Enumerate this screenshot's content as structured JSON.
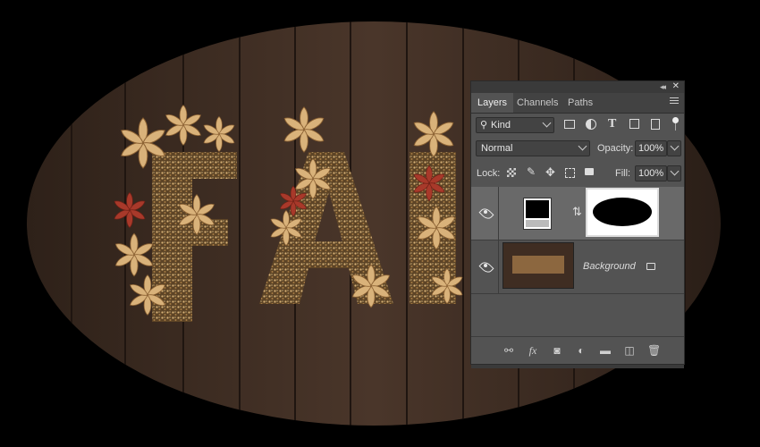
{
  "panel": {
    "tabs": [
      {
        "label": "Layers"
      },
      {
        "label": "Channels"
      },
      {
        "label": "Paths"
      }
    ],
    "filter": {
      "label": "Kind"
    },
    "blend_mode": "Normal",
    "opacity_label": "Opacity:",
    "opacity_value": "100%",
    "lock_label": "Lock:",
    "fill_label": "Fill:",
    "fill_value": "100%",
    "layers": [
      {
        "name": "",
        "selected": true
      },
      {
        "name": "Background",
        "selected": false
      }
    ]
  },
  "colors": {
    "panel_bg": "#535353",
    "selected_layer": "#696969",
    "wood": "#3b2a20",
    "gold": "#c9a36a",
    "red_leaf": "#a8392a"
  },
  "icons": [
    "search-icon",
    "image-filter-icon",
    "adjustment-filter-icon",
    "type-filter-icon",
    "shape-filter-icon",
    "smart-object-filter-icon",
    "filter-toggle",
    "lock-transparent-icon",
    "lock-pixels-icon",
    "lock-position-icon",
    "lock-artboard-icon",
    "lock-all-icon",
    "eye-icon",
    "link-icon",
    "lock-icon",
    "link-layers-icon",
    "fx-icon",
    "add-mask-icon",
    "new-adjustment-icon",
    "new-group-icon",
    "new-layer-icon",
    "delete-icon"
  ]
}
